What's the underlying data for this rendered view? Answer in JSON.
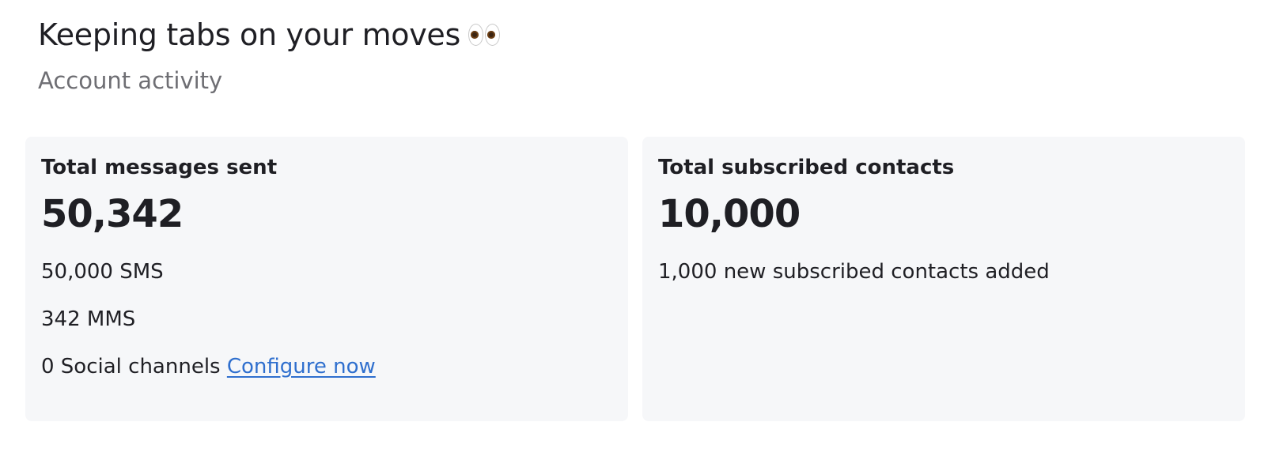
{
  "header": {
    "title": "Keeping tabs on your moves",
    "title_emoji": "eyes-icon",
    "subtitle": "Account activity"
  },
  "cards": {
    "messages": {
      "heading": "Total messages sent",
      "value": "50,342",
      "sms": "50,000 SMS",
      "mms": "342 MMS",
      "social": "0 Social channels",
      "configure_link": "Configure now"
    },
    "contacts": {
      "heading": "Total subscribed contacts",
      "value": "10,000",
      "new_added": "1,000 new subscribed contacts added"
    }
  },
  "colors": {
    "card_bg": "#f6f7f9",
    "link": "#2f6fce",
    "text": "#1f1f24",
    "subtext": "#6e6e73"
  }
}
